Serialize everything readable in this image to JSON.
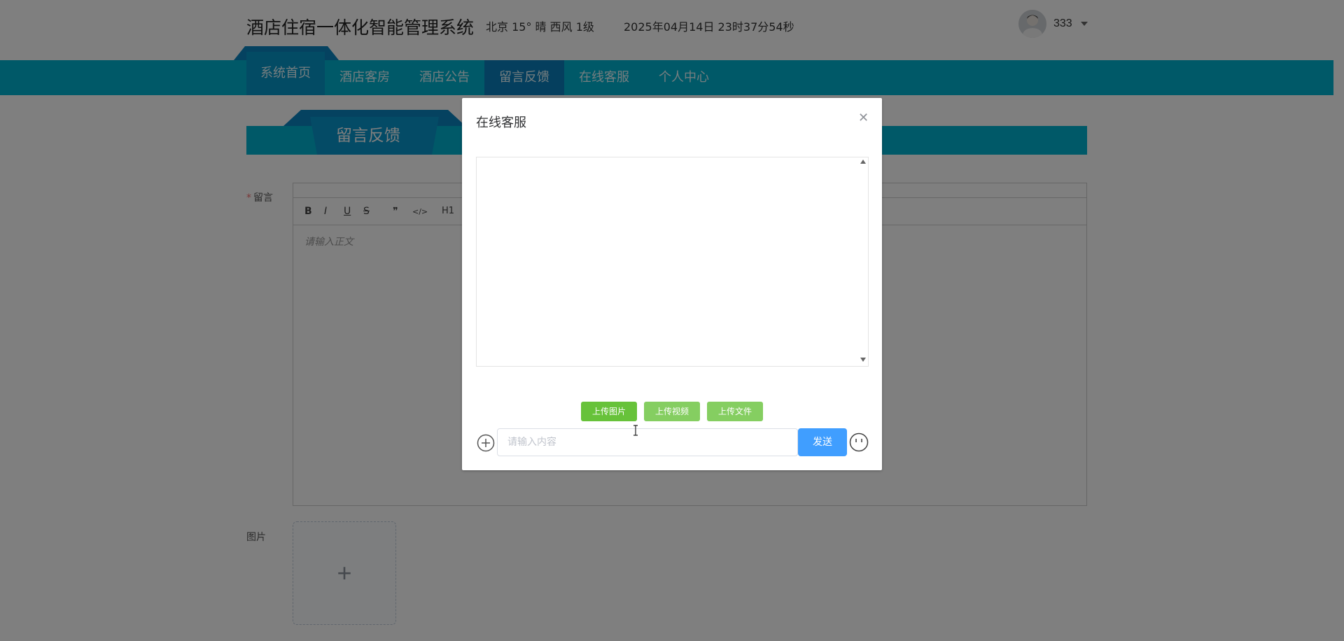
{
  "header": {
    "title": "酒店住宿一体化智能管理系统",
    "weather": "北京  15°  晴  西风  1级",
    "datetime": "2025年04月14日 23时37分54秒",
    "username": "333"
  },
  "nav": {
    "items": [
      {
        "label": "系统首页"
      },
      {
        "label": "酒店客房"
      },
      {
        "label": "酒店公告"
      },
      {
        "label": "留言反馈"
      },
      {
        "label": "在线客服"
      },
      {
        "label": "个人中心"
      }
    ]
  },
  "section": {
    "title": "留言反馈"
  },
  "form": {
    "message_label": "留言",
    "editor_placeholder": "请输入正文",
    "image_label": "图片",
    "toolbar": [
      "B",
      "I",
      "U",
      "S",
      "❞",
      "</>",
      "H1"
    ]
  },
  "dialog": {
    "title": "在线客服",
    "upload_image": "上传图片",
    "upload_video": "上传视频",
    "upload_file": "上传文件",
    "input_placeholder": "请输入内容",
    "send": "发送"
  },
  "colors": {
    "nav_bg": "#00b3d1",
    "nav_active": "#0a7fbc",
    "send_button": "#409eff",
    "upload_button": "#67c23a"
  }
}
